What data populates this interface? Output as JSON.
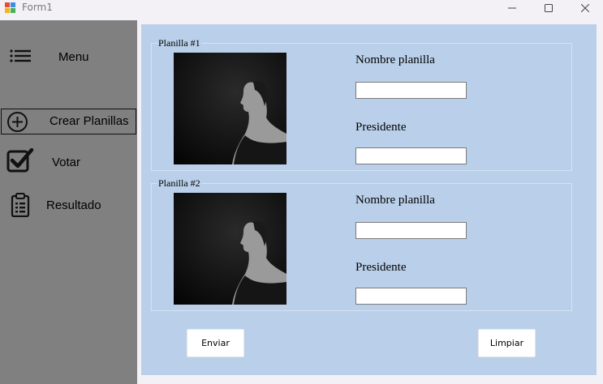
{
  "window": {
    "title": "Form1",
    "app_icon": "winforms-app-icon",
    "controls": [
      "minimize-icon",
      "maximize-icon",
      "close-icon"
    ]
  },
  "sidebar": {
    "menu_label": "Menu",
    "menu_icon": "hamburger-icon",
    "items": [
      {
        "label": "Crear Planillas",
        "icon": "plus-circle-icon"
      },
      {
        "label": "Votar",
        "icon": "checkbox-icon"
      },
      {
        "label": "Resultado",
        "icon": "clipboard-icon"
      }
    ]
  },
  "main": {
    "groups": [
      {
        "legend": "Planilla #1",
        "name_label": "Nombre planilla",
        "name_value": "",
        "president_label": "Presidente",
        "president_value": ""
      },
      {
        "legend": "Planilla #2",
        "name_label": "Nombre planilla",
        "name_value": "",
        "president_label": "Presidente",
        "president_value": ""
      }
    ],
    "buttons": {
      "send": "Enviar",
      "clear": "Limpiar"
    }
  },
  "colors": {
    "sidebar": "#808080",
    "panel": "#bad0ea",
    "window_bg": "#f3f0f6"
  }
}
